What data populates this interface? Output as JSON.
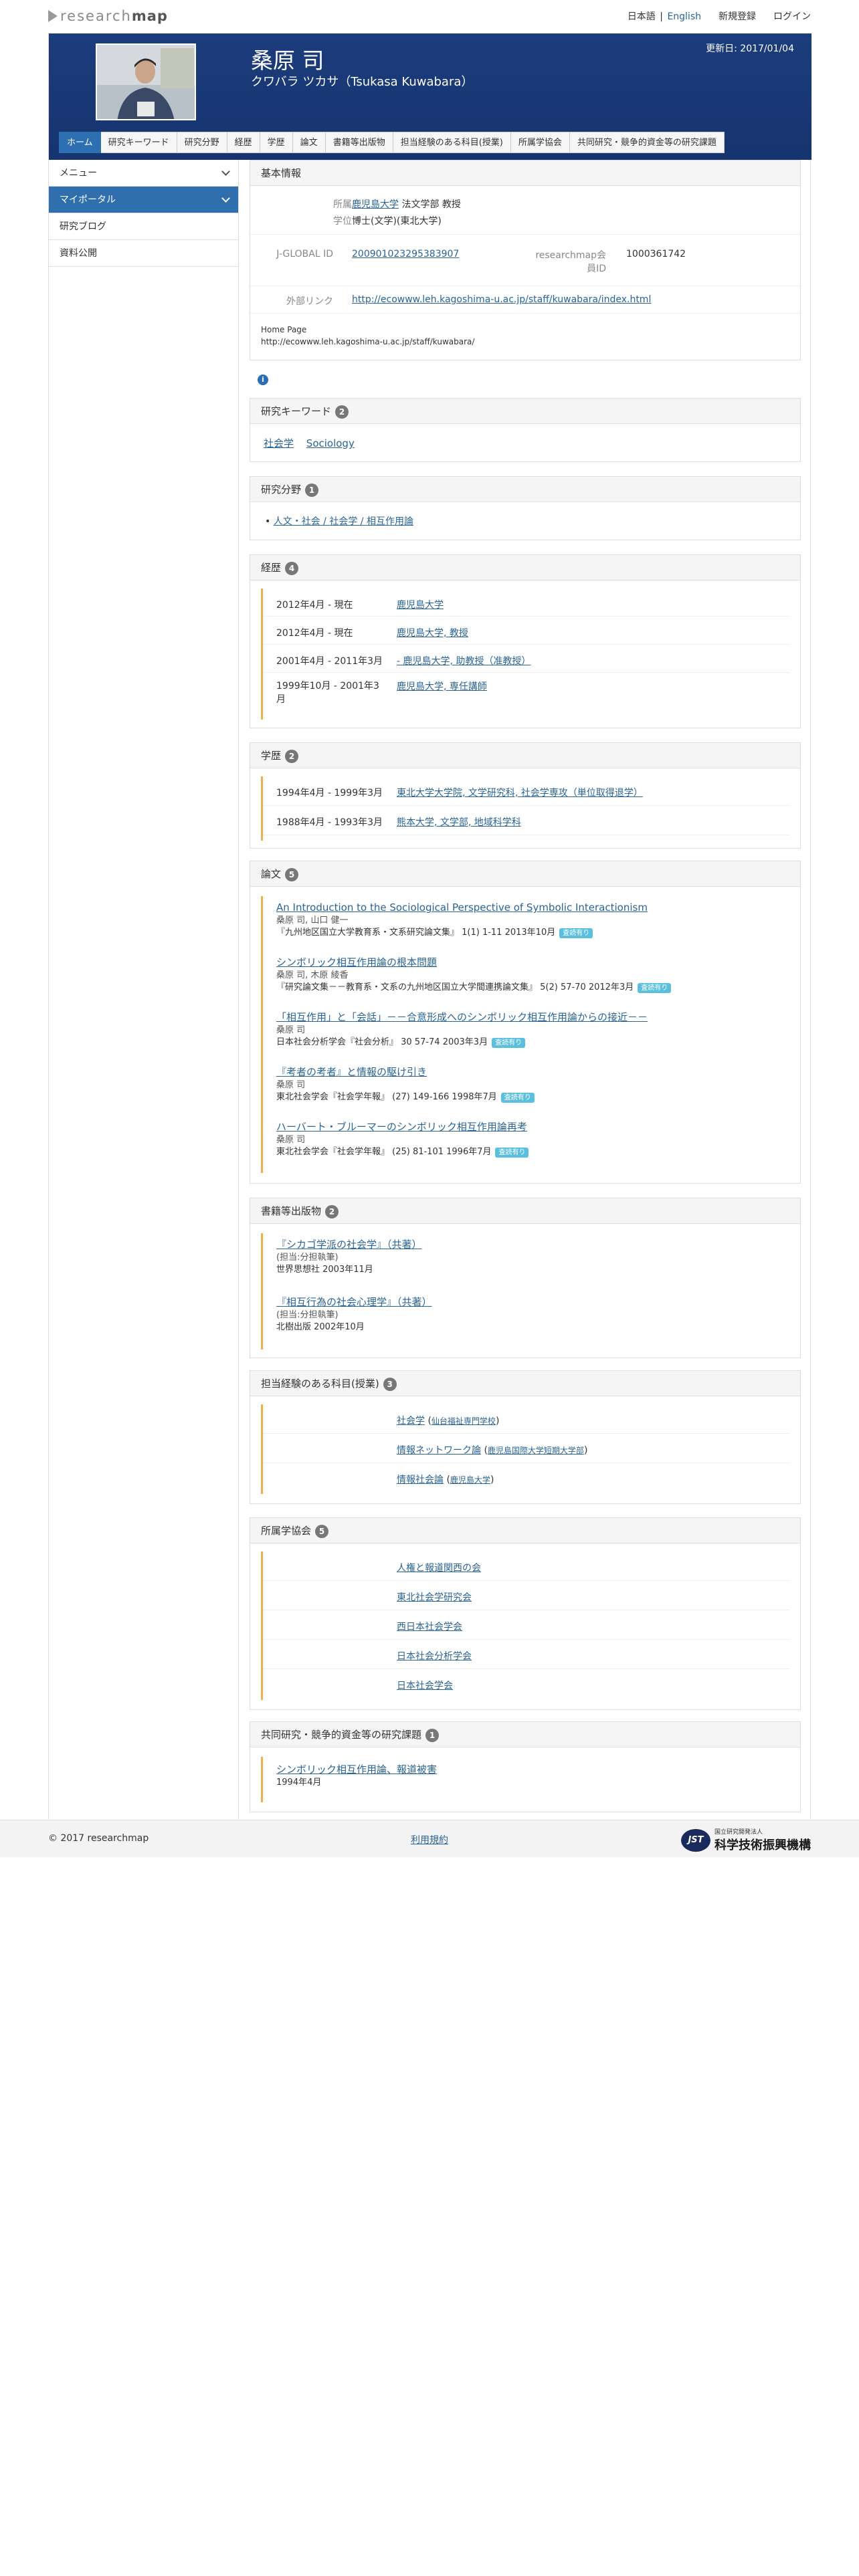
{
  "topbar": {
    "logo_light": "research",
    "logo_dark": "map",
    "lang_ja": "日本語",
    "lang_sep": "|",
    "lang_en": "English",
    "register": "新規登録",
    "login": "ログイン"
  },
  "hero": {
    "name": "桑原 司",
    "kana": "クワバラ ツカサ（Tsukasa Kuwabara）",
    "updated": "更新日: 2017/01/04"
  },
  "tabs": [
    "ホーム",
    "研究キーワード",
    "研究分野",
    "経歴",
    "学歴",
    "論文",
    "書籍等出版物",
    "担当経験のある科目(授業)",
    "所属学協会",
    "共同研究・競争的資金等の研究課題"
  ],
  "sidebar": {
    "menu": "メニュー",
    "mypage": "マイポータル",
    "blog": "研究ブログ",
    "files": "資料公開"
  },
  "basic": {
    "head": "基本情報",
    "aff_k": "所属",
    "aff_link": "鹿児島大学",
    "aff_rest": " 法文学部 教授",
    "deg_k": "学位",
    "deg_v": "博士(文学)(東北大学)",
    "jg_k": "J-GLOBAL ID",
    "jg_v": "200901023295383907",
    "rm_k": "researchmap会員ID",
    "rm_v": "1000361742",
    "ext_k": "外部リンク",
    "ext_v": "http://ecowww.leh.kagoshima-u.ac.jp/staff/kuwabara/index.html",
    "hp_label": "Home Page",
    "hp_url": "http://ecowww.leh.kagoshima-u.ac.jp/staff/kuwabara/",
    "info": "i"
  },
  "keywords": {
    "head": "研究キーワード",
    "count": "2",
    "items": [
      "社会学",
      "Sociology"
    ]
  },
  "fields": {
    "head": "研究分野",
    "count": "1",
    "items": [
      "人文・社会 / 社会学 / 相互作用論"
    ]
  },
  "career": {
    "head": "経歴",
    "count": "4",
    "rows": [
      {
        "d": "2012年4月 - 現在",
        "v": "鹿児島大学"
      },
      {
        "d": "2012年4月 - 現在",
        "v": "鹿児島大学, 教授"
      },
      {
        "d": "2001年4月 - 2011年3月",
        "v": "- 鹿児島大学, 助教授（准教授）"
      },
      {
        "d": "1999年10月 - 2001年3",
        "d2": "月",
        "v": "鹿児島大学, 専任講師"
      }
    ]
  },
  "education": {
    "head": "学歴",
    "count": "2",
    "rows": [
      {
        "d": "1994年4月 - 1999年3月",
        "v": "東北大学大学院, 文学研究科, 社会学専攻（単位取得退学）"
      },
      {
        "d": "1988年4月 - 1993年3月",
        "v": "熊本大学, 文学部, 地域科学科"
      }
    ]
  },
  "papers": {
    "head": "論文",
    "count": "5",
    "items": [
      {
        "title": "An Introduction to the Sociological Perspective of Symbolic Interactionism",
        "authors": "桑原 司, 山口 健一",
        "source": "『九州地区国立大学教育系・文系研究論文集』 1(1) 1-11 2013年10月",
        "tag": "査読有り"
      },
      {
        "title": "シンボリック相互作用論の根本問題",
        "authors": "桑原 司, 木原 綾香",
        "source": "『研究論文集－－教育系・文系の九州地区国立大学間連携論文集』 5(2) 57-70 2012年3月",
        "tag": "査読有り"
      },
      {
        "title": "「相互作用」と「会話」－－合意形成へのシンボリック相互作用論からの接近－－",
        "authors": "桑原 司",
        "source": "日本社会分析学会『社会分析』 30 57-74 2003年3月",
        "tag": "査読有り"
      },
      {
        "title": "『考者の考者』と情報の駆け引き",
        "authors": "桑原 司",
        "source": "東北社会学会『社会学年報』 (27) 149-166 1998年7月",
        "tag": "査読有り"
      },
      {
        "title": "ハーバート・ブルーマーのシンボリック相互作用論再考",
        "authors": "桑原 司",
        "source": "東北社会学会『社会学年報』 (25) 81-101 1996年7月",
        "tag": "査読有り"
      }
    ]
  },
  "books": {
    "head": "書籍等出版物",
    "count": "2",
    "items": [
      {
        "title": "『シカゴ学派の社会学』（共著）",
        "role": "(担当:分担執筆)",
        "pub": "世界思想社 2003年11月"
      },
      {
        "title": "『相互行為の社会心理学』（共著）",
        "role": "(担当:分担執筆)",
        "pub": "北樹出版 2002年10月"
      }
    ]
  },
  "courses": {
    "head": "担当経験のある科目(授業)",
    "count": "3",
    "items": [
      {
        "name": "社会学",
        "inst": "仙台福祉専門学校",
        "open": " (",
        "close": ")"
      },
      {
        "name": "情報ネットワーク論",
        "inst": "鹿児島国際大学短期大学部",
        "open": " (",
        "close": ")"
      },
      {
        "name": "情報社会論",
        "inst": "鹿児島大学",
        "open": " (",
        "close": ")"
      }
    ]
  },
  "societies": {
    "head": "所属学協会",
    "count": "5",
    "items": [
      "人権と報道関西の会",
      "東北社会学研究会",
      "西日本社会学会",
      "日本社会分析学会",
      "日本社会学会"
    ]
  },
  "grants": {
    "head": "共同研究・競争的資金等の研究課題",
    "count": "1",
    "title": "シンボリック相互作用論、報道被害",
    "date": "1994年4月"
  },
  "footer": {
    "copy": "2017 researchmap",
    "terms": "利用規約",
    "jst_mark": "JST",
    "jst_sub": "国立研究開発法人",
    "jst_big": "科学技術振興機構"
  }
}
